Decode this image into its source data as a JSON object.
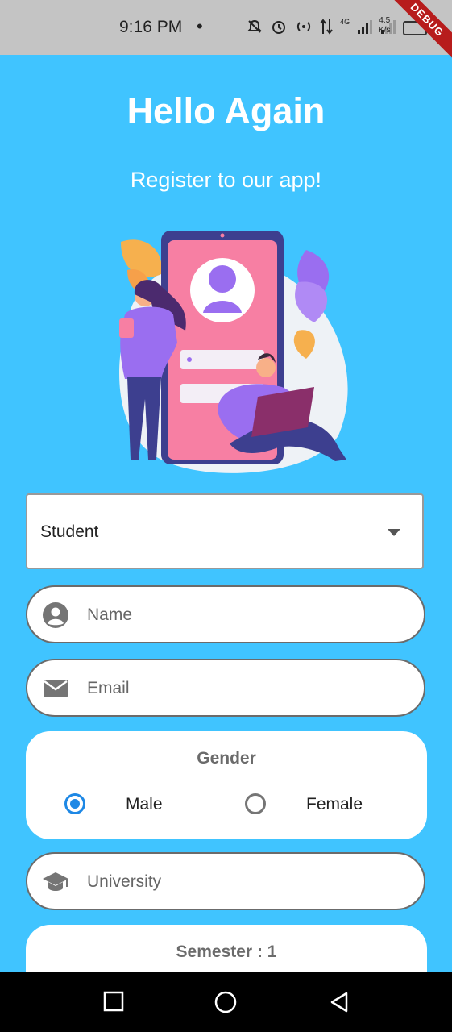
{
  "status_bar": {
    "time": "9:16 PM",
    "dot": "•",
    "icons": [
      "mute-icon",
      "alarm-icon",
      "hotspot-icon",
      "data-icon",
      "signal-4g-icon",
      "signal-icon",
      "battery-icon"
    ],
    "network": "4G",
    "speed_value": "4.5",
    "speed_unit": "K/s",
    "debug_banner": "DEBUG"
  },
  "header": {
    "title": "Hello Again",
    "subtitle": "Register to our app!"
  },
  "form": {
    "role_dropdown": {
      "selected": "Student"
    },
    "name_field": {
      "placeholder": "Name",
      "value": ""
    },
    "email_field": {
      "placeholder": "Email",
      "value": ""
    },
    "gender": {
      "title": "Gender",
      "options": [
        {
          "label": "Male",
          "selected": true
        },
        {
          "label": "Female",
          "selected": false
        }
      ]
    },
    "university_field": {
      "placeholder": "University",
      "value": ""
    },
    "semester": {
      "label": "Semester : 1"
    }
  },
  "colors": {
    "background": "#40c4ff",
    "accent": "#1e88e5",
    "debug_ribbon": "#b71c1c"
  },
  "nav_bar": {
    "buttons": [
      "recent-apps-icon",
      "home-icon",
      "back-icon"
    ]
  }
}
